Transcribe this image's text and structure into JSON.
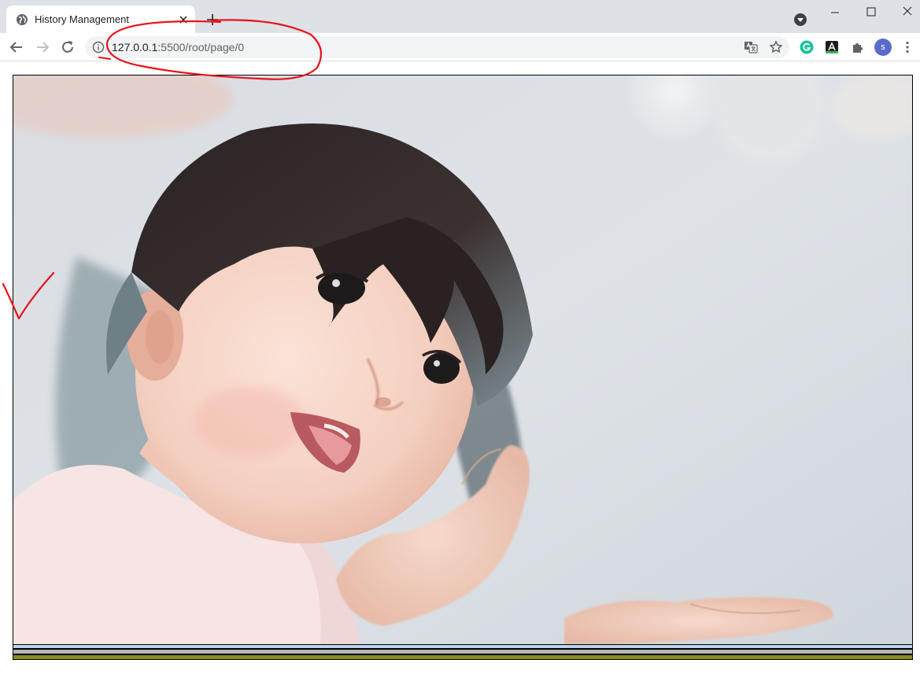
{
  "tab": {
    "title": "History Management",
    "favicon": "globe-icon"
  },
  "omnibox": {
    "url_host": "127.0.0.1",
    "url_path": ":5500/root/page/0"
  },
  "profile": {
    "initial": "s",
    "color": "#5b6bc9"
  },
  "page": {
    "image_alt": "Photo of a young girl holding out her hand",
    "stripe_colors": [
      "#b8d5ec",
      "#b7b7b7",
      "#8a8a20"
    ]
  },
  "annotations": {
    "color": "#e8141b",
    "marks": [
      "circle-around-url",
      "checkmark-left"
    ]
  }
}
